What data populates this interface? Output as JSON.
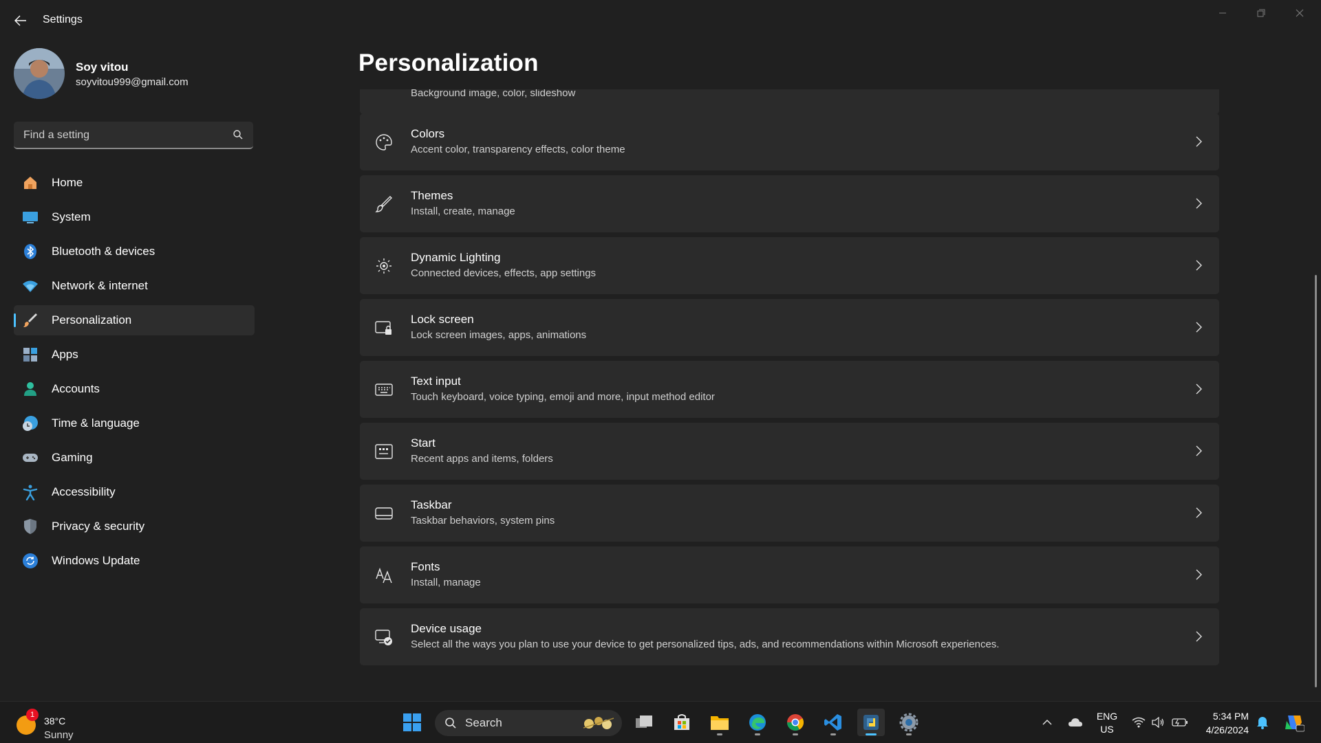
{
  "app": {
    "title": "Settings",
    "window_controls": [
      "minimize-icon",
      "restore-icon",
      "close-icon"
    ]
  },
  "profile": {
    "name": "Soy vitou",
    "email": "soyvitou999@gmail.com"
  },
  "search": {
    "placeholder": "Find a setting"
  },
  "sidebar": {
    "active_index": 4,
    "items": [
      {
        "label": "Home",
        "icon": "home-icon"
      },
      {
        "label": "System",
        "icon": "system-icon"
      },
      {
        "label": "Bluetooth & devices",
        "icon": "bluetooth-icon"
      },
      {
        "label": "Network & internet",
        "icon": "wifi-icon"
      },
      {
        "label": "Personalization",
        "icon": "brush-icon"
      },
      {
        "label": "Apps",
        "icon": "apps-icon"
      },
      {
        "label": "Accounts",
        "icon": "accounts-icon"
      },
      {
        "label": "Time & language",
        "icon": "clock-globe-icon"
      },
      {
        "label": "Gaming",
        "icon": "gamepad-icon"
      },
      {
        "label": "Accessibility",
        "icon": "accessibility-icon"
      },
      {
        "label": "Privacy & security",
        "icon": "shield-icon"
      },
      {
        "label": "Windows Update",
        "icon": "update-icon"
      }
    ]
  },
  "page": {
    "title": "Personalization"
  },
  "settings": [
    {
      "title": "",
      "subtitle": "Background image, color, slideshow",
      "icon": "background-icon"
    },
    {
      "title": "Colors",
      "subtitle": "Accent color, transparency effects, color theme",
      "icon": "palette-icon"
    },
    {
      "title": "Themes",
      "subtitle": "Install, create, manage",
      "icon": "brush-icon"
    },
    {
      "title": "Dynamic Lighting",
      "subtitle": "Connected devices, effects, app settings",
      "icon": "lighting-icon"
    },
    {
      "title": "Lock screen",
      "subtitle": "Lock screen images, apps, animations",
      "icon": "lock-screen-icon"
    },
    {
      "title": "Text input",
      "subtitle": "Touch keyboard, voice typing, emoji and more, input method editor",
      "icon": "keyboard-icon"
    },
    {
      "title": "Start",
      "subtitle": "Recent apps and items, folders",
      "icon": "start-icon"
    },
    {
      "title": "Taskbar",
      "subtitle": "Taskbar behaviors, system pins",
      "icon": "taskbar-icon"
    },
    {
      "title": "Fonts",
      "subtitle": "Install, manage",
      "icon": "fonts-icon"
    },
    {
      "title": "Device usage",
      "subtitle": "Select all the ways you plan to use your device to get personalized tips, ads, and recommendations within Microsoft experiences.",
      "icon": "device-usage-icon"
    }
  ],
  "taskbar": {
    "weather": {
      "temp": "38°C",
      "condition": "Sunny",
      "badge": "1"
    },
    "search_label": "Search",
    "apps": [
      "windows-start-icon",
      "task-view-icon",
      "store-icon",
      "file-explorer-icon",
      "edge-icon",
      "chrome-icon",
      "vscode-icon",
      "python-app-icon",
      "settings-app-icon"
    ],
    "lang_line1": "ENG",
    "lang_line2": "US",
    "time": "5:34 PM",
    "date": "4/26/2024"
  },
  "colors": {
    "accent": "#4cc2ff",
    "background": "#202020",
    "card": "#2b2b2b"
  }
}
